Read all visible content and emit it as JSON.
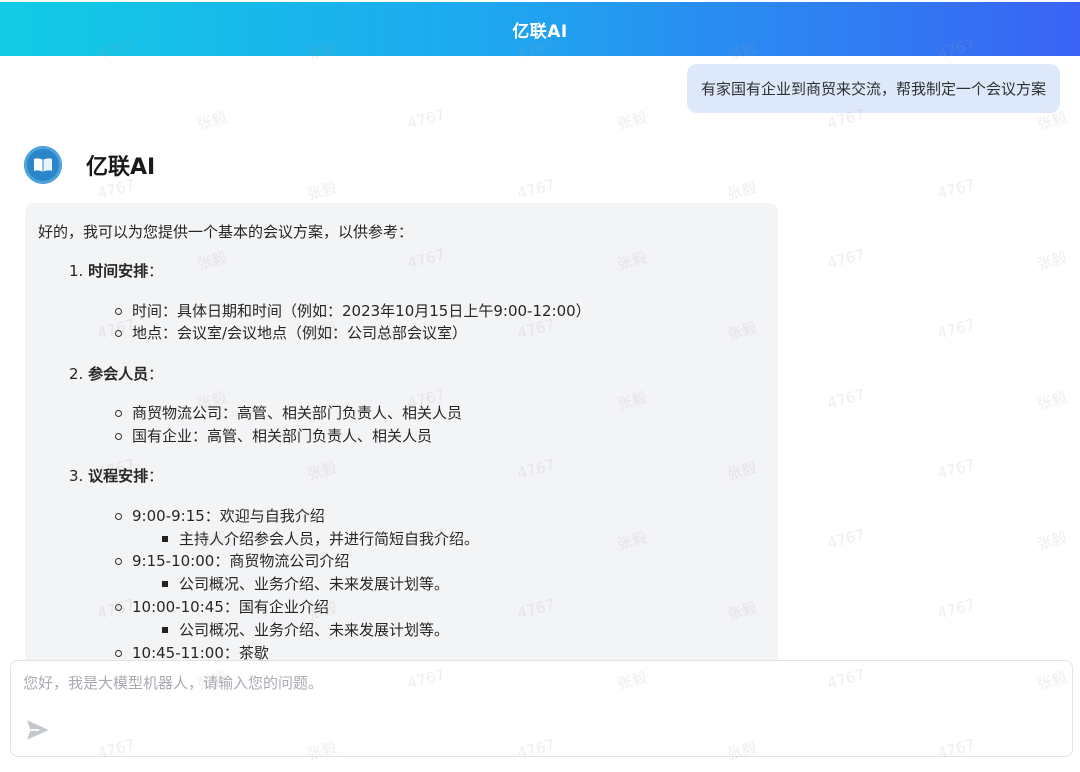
{
  "header": {
    "title": "亿联AI"
  },
  "user_message": {
    "text": "有家国有企业到商贸来交流，帮我制定一个会议方案"
  },
  "bot": {
    "name": "亿联AI",
    "avatar_icon": "book-icon",
    "avatar_color": "#2a86c8"
  },
  "answer": {
    "intro": "好的，我可以为您提供一个基本的会议方案，以供参考：",
    "sections": [
      {
        "num": "1.",
        "title": "时间安排",
        "colon": "：",
        "items": [
          {
            "text": "时间：具体日期和时间（例如：2023年10月15日上午9:00-12:00）"
          },
          {
            "text": "地点：会议室/会议地点（例如：公司总部会议室）"
          }
        ]
      },
      {
        "num": "2.",
        "title": "参会人员",
        "colon": "：",
        "items": [
          {
            "text": "商贸物流公司：高管、相关部门负责人、相关人员"
          },
          {
            "text": "国有企业：高管、相关部门负责人、相关人员"
          }
        ]
      },
      {
        "num": "3.",
        "title": "议程安排",
        "colon": "：",
        "items": [
          {
            "text": "9:00-9:15：欢迎与自我介绍",
            "sub": "主持人介绍参会人员，并进行简短自我介绍。"
          },
          {
            "text": "9:15-10:00：商贸物流公司介绍",
            "sub": "公司概况、业务介绍、未来发展计划等。"
          },
          {
            "text": "10:00-10:45：国有企业介绍",
            "sub": "公司概况、业务介绍、未来发展计划等。"
          },
          {
            "text": "10:45-11:00：茶歇"
          }
        ]
      }
    ]
  },
  "input": {
    "placeholder": "您好，我是大模型机器人，请输入您的问题。",
    "value": ""
  },
  "send_button": {
    "icon": "send-icon"
  },
  "watermarks": [
    "4767",
    "张毅"
  ],
  "colors": {
    "header_start": "#12cbe4",
    "header_end": "#3a63f4",
    "user_bubble": "#dde9fb",
    "answer_bg": "#f3f4f6"
  }
}
